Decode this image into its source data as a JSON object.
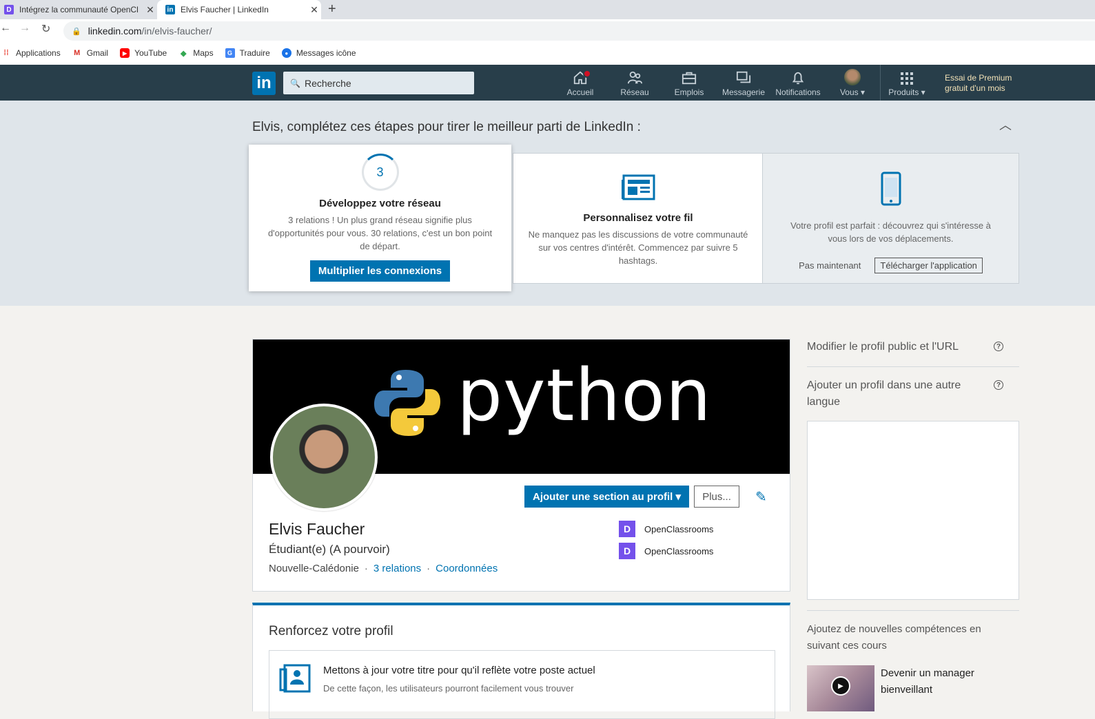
{
  "browser": {
    "tabs": [
      {
        "title": "Intégrez la communauté OpenCl",
        "close": "✕"
      },
      {
        "title": "Elvis Faucher | LinkedIn",
        "close": "✕"
      }
    ],
    "new_tab": "+",
    "url_domain": "linkedin.com",
    "url_path": "/in/elvis-faucher/",
    "bookmarks": [
      "Applications",
      "Gmail",
      "YouTube",
      "Maps",
      "Traduire",
      "Messages icône"
    ]
  },
  "linkedin_nav": {
    "logo": "in",
    "search_placeholder": "Recherche",
    "items": [
      {
        "label": "Accueil",
        "icon": "home-icon"
      },
      {
        "label": "Réseau",
        "icon": "network-icon"
      },
      {
        "label": "Emplois",
        "icon": "briefcase-icon"
      },
      {
        "label": "Messagerie",
        "icon": "messaging-icon"
      },
      {
        "label": "Notifications",
        "icon": "bell-icon"
      },
      {
        "label": "Vous ▾",
        "icon": "avatar"
      },
      {
        "label": "Produits ▾",
        "icon": "grid-icon"
      }
    ],
    "premium_line1": "Essai de Premium",
    "premium_line2": "gratuit d'un mois"
  },
  "onboarding": {
    "title": "Elvis, complétez ces étapes pour tirer le meilleur parti de LinkedIn :",
    "cards": [
      {
        "ring_value": "3",
        "title": "Développez votre réseau",
        "text": "3 relations ! Un plus grand réseau signifie plus d'opportunités pour vous. 30 relations, c'est un bon point de départ.",
        "button": "Multiplier les connexions"
      },
      {
        "title": "Personnalisez votre fil",
        "text": "Ne manquez pas les discussions de votre communauté sur vos centres d'intérêt. Commencez par suivre 5 hashtags."
      },
      {
        "text": "Votre profil est parfait : découvrez qui s'intéresse à vous lors de vos déplacements.",
        "secondary": "Pas maintenant",
        "button": "Télécharger l'application"
      }
    ]
  },
  "profile": {
    "banner_text": "python",
    "name": "Elvis Faucher",
    "headline": "Étudiant(e) (A pourvoir)",
    "location": "Nouvelle-Calédonie",
    "relations": "3 relations",
    "contact": "Coordonnées",
    "add_section": "Ajouter une section au profil ▾",
    "more": "Plus...",
    "orgs": [
      "OpenClassrooms",
      "OpenClassrooms"
    ]
  },
  "strengthen": {
    "title": "Renforcez votre profil",
    "item_title": "Mettons à jour votre titre pour qu'il reflète votre poste actuel",
    "item_sub": "De cette façon, les utilisateurs pourront facilement vous trouver"
  },
  "rail": {
    "public_profile": "Modifier le profil public et l'URL",
    "other_language": "Ajouter un profil dans une autre langue",
    "courses_intro": "Ajoutez de nouvelles compétences en suivant ces cours",
    "course_title": "Devenir un manager bienveillant"
  },
  "colors": {
    "linkedin_blue": "#0073b1",
    "nav_bg": "#283e4a",
    "openclassrooms": "#7451eb"
  }
}
